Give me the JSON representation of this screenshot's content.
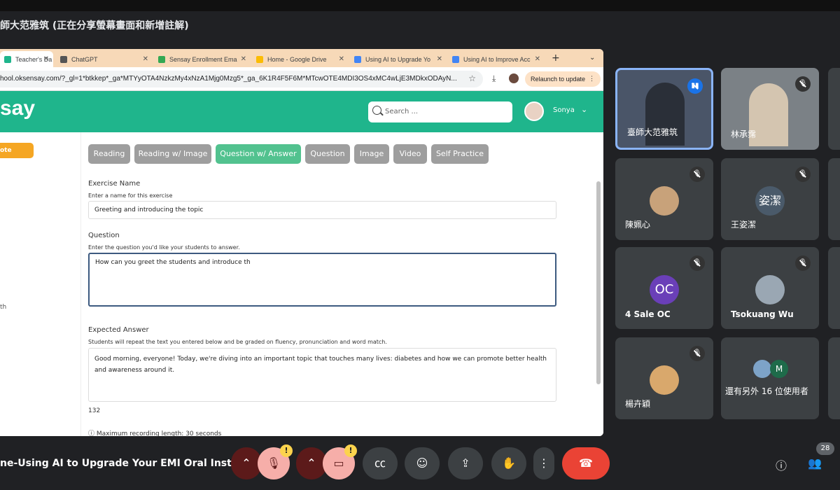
{
  "meet": {
    "presenter_caption": "師大范雅筑 (正在分享螢幕畫面和新增註解)",
    "meeting_name": "ne-Using AI to Upgrade Your EMI Oral Inst...",
    "participant_count": "28"
  },
  "browser": {
    "tabs": [
      {
        "label": "Teacher's Da",
        "color": "#1fb58c"
      },
      {
        "label": "ChatGPT",
        "color": "#555555"
      },
      {
        "label": "Sensay Enrollment Ema",
        "color": "#34a853"
      },
      {
        "label": "Home - Google Drive",
        "color": "#fbbc04"
      },
      {
        "label": "Using AI to Upgrade Yo",
        "color": "#4285f4"
      },
      {
        "label": "Using AI to Improve Acc",
        "color": "#4285f4"
      }
    ],
    "new_tab": "+",
    "url": "hool.oksensay.com/?_gl=1*btkkep*_ga*MTYyOTA4NzkzMy4xNzA1Mjg0Mzg5*_ga_6K1R4F5F6M*MTcwOTE4MDI3OS4xMC4wLjE3MDkxODAyN...",
    "relaunch_label": "Relaunch to update"
  },
  "app": {
    "logo": "say",
    "search_placeholder": "Search ...",
    "user_name": "Sonya",
    "left_button": "ote",
    "left_text": "th"
  },
  "exercise": {
    "types": [
      "Reading",
      "Reading w/ Image",
      "Question w/ Answer",
      "Question",
      "Image",
      "Video",
      "Self Practice"
    ],
    "name_label": "Exercise Name",
    "name_hint": "Enter a name for this exercise",
    "name_value": "Greeting and introducing the topic",
    "question_label": "Question",
    "question_hint": "Enter the question you'd like your students to answer.",
    "question_value": "How can you greet the students and introduce th",
    "answer_label": "Expected Answer",
    "answer_hint": "Students will repeat the text you entered below and be graded on fluency, pronunciation and word match.",
    "answer_value": "Good morning, everyone! Today, we're diving into an important topic that touches many lives: diabetes and how we can promote better health and awareness around it.",
    "char_count": "132",
    "max_recording": "Maximum recording length: 30 seconds"
  },
  "participants": [
    {
      "name": "臺師大范雅筑",
      "initial": "",
      "color": "#5b6f8a"
    },
    {
      "name": "林承霈",
      "initial": "",
      "color": "#8a8f94"
    },
    {
      "name": "陳姵心",
      "initial": "",
      "color": "#c8a27a"
    },
    {
      "name": "王姿潔",
      "initial": "姿潔",
      "color": "#4a5a6a"
    },
    {
      "name": "4 Sale OC",
      "initial": "OC",
      "color": "#6a3fb8"
    },
    {
      "name": "Tsokuang Wu",
      "initial": "",
      "color": "#9aa7b3"
    },
    {
      "name": "楊卉穎",
      "initial": "",
      "color": "#d9a86c"
    },
    {
      "name": "還有另外 16 位使用者",
      "initial": "M",
      "color": "#1e6b4a"
    }
  ]
}
